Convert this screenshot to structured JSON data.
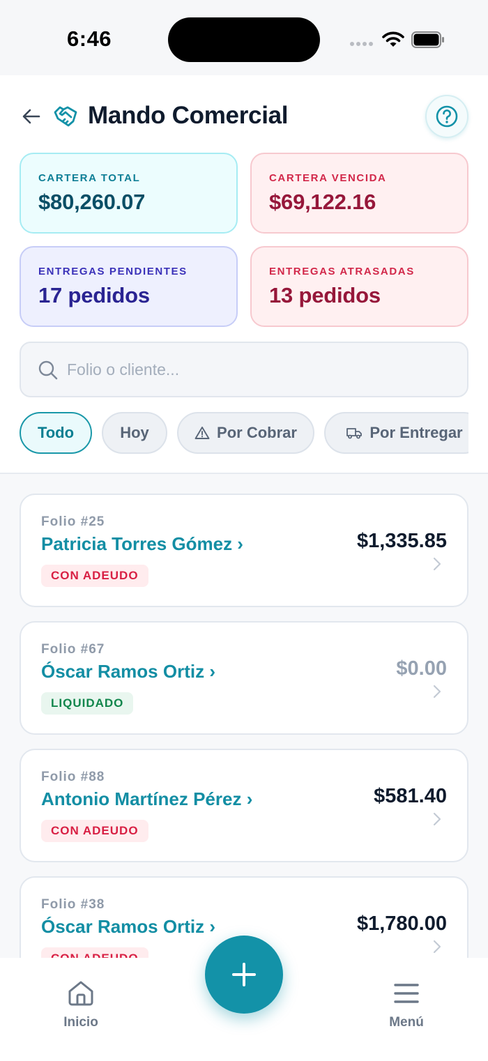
{
  "status_bar": {
    "time": "6:46"
  },
  "header": {
    "title": "Mando Comercial"
  },
  "stats": [
    {
      "label": "CARTERA TOTAL",
      "value": "$80,260.07"
    },
    {
      "label": "CARTERA VENCIDA",
      "value": "$69,122.16"
    },
    {
      "label": "ENTREGAS PENDIENTES",
      "value": "17 pedidos"
    },
    {
      "label": "ENTREGAS ATRASADAS",
      "value": "13 pedidos"
    }
  ],
  "search": {
    "placeholder": "Folio o cliente...",
    "value": ""
  },
  "filters": [
    {
      "label": "Todo",
      "active": true
    },
    {
      "label": "Hoy",
      "active": false
    },
    {
      "label": "Por Cobrar",
      "icon": "warning-icon",
      "active": false
    },
    {
      "label": "Por Entregar",
      "icon": "truck-icon",
      "active": false
    }
  ],
  "orders": [
    {
      "folio": "Folio #25",
      "client": "Patricia Torres Gómez ›",
      "status": "CON ADEUDO",
      "amount": "$1,335.85"
    },
    {
      "folio": "Folio #67",
      "client": "Óscar Ramos Ortiz ›",
      "status": "LIQUIDADO",
      "amount": "$0.00"
    },
    {
      "folio": "Folio #88",
      "client": "Antonio Martínez Pérez ›",
      "status": "CON ADEUDO",
      "amount": "$581.40"
    },
    {
      "folio": "Folio #38",
      "client": "Óscar Ramos Ortiz ›",
      "status": "CON ADEUDO",
      "amount": "$1,780.00"
    }
  ],
  "bottom_nav": {
    "home_label": "Inicio",
    "menu_label": "Menú",
    "fab_icon": "plus-icon"
  },
  "colors": {
    "accent": "#1392a8",
    "danger": "#d81f43",
    "success": "#12864c"
  }
}
